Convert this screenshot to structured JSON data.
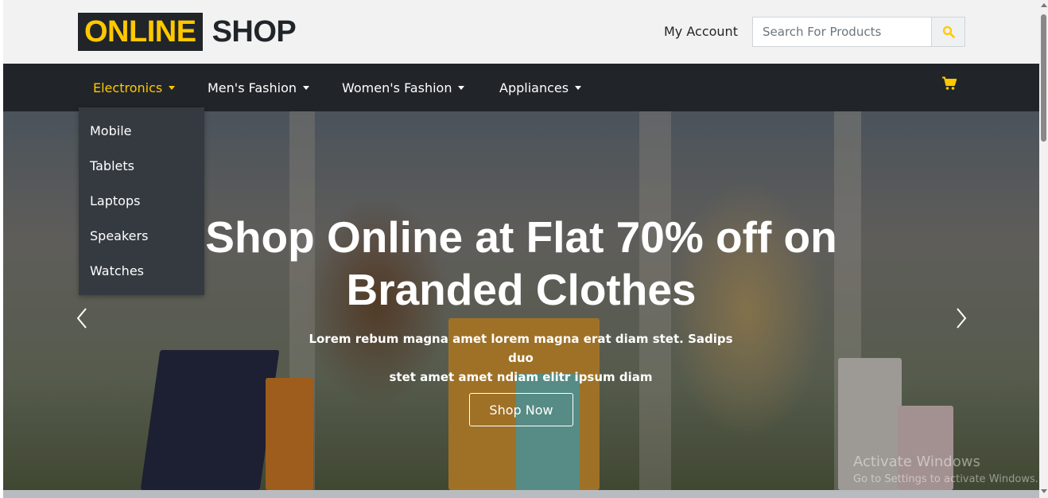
{
  "logo": {
    "part1": "ONLINE",
    "part2": "SHOP"
  },
  "header": {
    "account_label": "My Account",
    "search_placeholder": "Search For Products",
    "search_icon": "search-icon"
  },
  "nav": {
    "items": [
      {
        "label": "Electronics",
        "active": true
      },
      {
        "label": "Men's Fashion",
        "active": false
      },
      {
        "label": "Women's Fashion",
        "active": false
      },
      {
        "label": "Appliances",
        "active": false
      }
    ],
    "cart_icon": "cart-icon"
  },
  "dropdown": {
    "items": [
      "Mobile",
      "Tablets",
      "Laptops",
      "Speakers",
      "Watches"
    ]
  },
  "hero": {
    "title_line1": "Shop Online at Flat 70% off on",
    "title_line2": "Branded Clothes",
    "text_line1": "Lorem rebum magna amet lorem magna erat diam stet. Sadips duo",
    "text_line2": "stet amet amet ndiam elitr ipsum diam",
    "button_label": "Shop Now"
  },
  "watermark": {
    "line1": "Activate Windows",
    "line2": "Go to Settings to activate Windows."
  },
  "colors": {
    "accent": "#ffc800",
    "dark": "#212529",
    "dropdown_bg": "#343a40"
  }
}
